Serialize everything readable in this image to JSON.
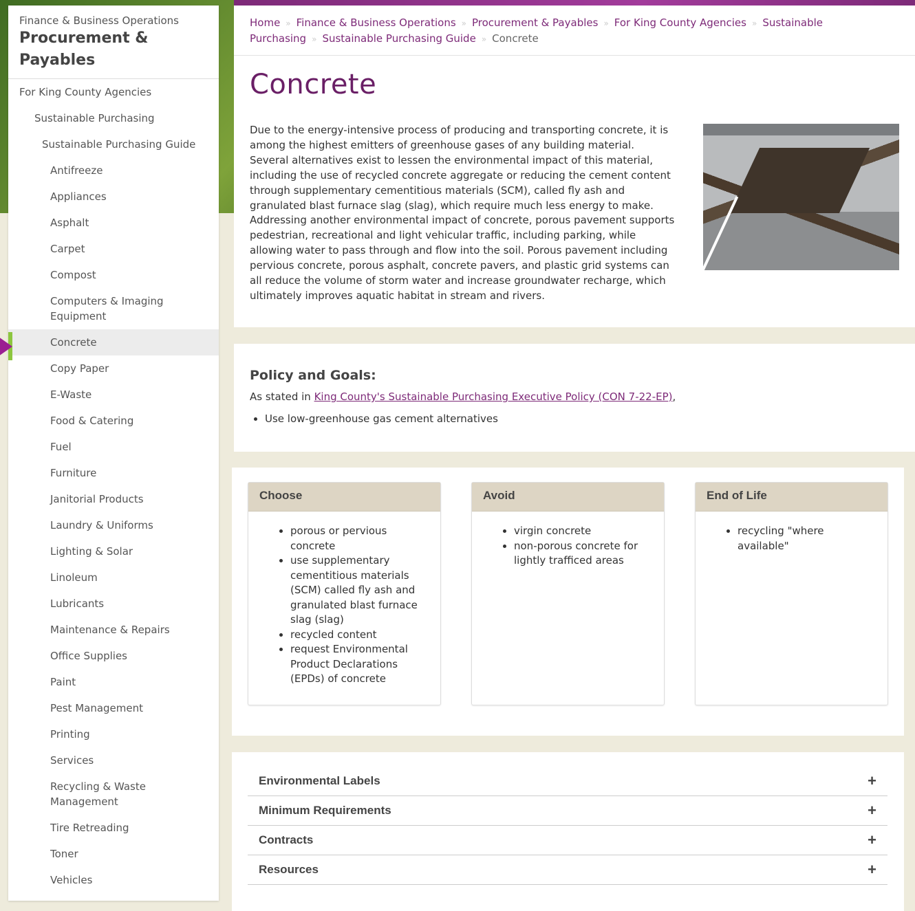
{
  "sidebar": {
    "kicker": "Finance & Business Operations",
    "title": "Procurement & Payables",
    "items": [
      {
        "label": "For King County Agencies",
        "level": 0
      },
      {
        "label": "Sustainable Purchasing",
        "level": 1
      },
      {
        "label": "Sustainable Purchasing Guide",
        "level": 2
      },
      {
        "label": "Antifreeze",
        "level": 3
      },
      {
        "label": "Appliances",
        "level": 3
      },
      {
        "label": "Asphalt",
        "level": 3
      },
      {
        "label": "Carpet",
        "level": 3
      },
      {
        "label": "Compost",
        "level": 3
      },
      {
        "label": "Computers & Imaging Equipment",
        "level": 3
      },
      {
        "label": "Concrete",
        "level": 3,
        "active": true
      },
      {
        "label": "Copy Paper",
        "level": 3
      },
      {
        "label": "E-Waste",
        "level": 3
      },
      {
        "label": "Food & Catering",
        "level": 3
      },
      {
        "label": "Fuel",
        "level": 3
      },
      {
        "label": "Furniture",
        "level": 3
      },
      {
        "label": "Janitorial Products",
        "level": 3
      },
      {
        "label": "Laundry & Uniforms",
        "level": 3
      },
      {
        "label": "Lighting & Solar",
        "level": 3
      },
      {
        "label": "Linoleum",
        "level": 3
      },
      {
        "label": "Lubricants",
        "level": 3
      },
      {
        "label": "Maintenance & Repairs",
        "level": 3
      },
      {
        "label": "Office Supplies",
        "level": 3
      },
      {
        "label": "Paint",
        "level": 3
      },
      {
        "label": "Pest Management",
        "level": 3
      },
      {
        "label": "Printing",
        "level": 3
      },
      {
        "label": "Services",
        "level": 3
      },
      {
        "label": "Recycling & Waste Management",
        "level": 3
      },
      {
        "label": "Tire Retreading",
        "level": 3
      },
      {
        "label": "Toner",
        "level": 3
      },
      {
        "label": "Vehicles",
        "level": 3
      }
    ]
  },
  "breadcrumb": {
    "items": [
      "Home",
      "Finance & Business Operations",
      "Procurement & Payables",
      "For King County Agencies",
      "Sustainable Purchasing",
      "Sustainable Purchasing Guide"
    ],
    "current": "Concrete"
  },
  "page": {
    "title": "Concrete",
    "intro": "Due to the energy-intensive process of producing and transporting concrete, it is among the highest emitters of greenhouse gases of any building material. Several alternatives exist to lessen the environmental impact of this material, including the use of recycled concrete aggregate or reducing the cement content through supplementary cementitious materials (SCM), called fly ash and granulated blast furnace slag (slag), which require much less energy to make. Addressing another environmental impact of concrete, porous pavement supports pedestrian, recreational and light vehicular traffic, including parking, while allowing water to pass through and flow into the soil. Porous pavement including pervious concrete, porous asphalt, concrete pavers, and plastic grid systems can all reduce the volume of storm water and increase groundwater recharge, which ultimately improves aquatic habitat in stream and rivers."
  },
  "policy": {
    "heading": "Policy and Goals:",
    "stated_prefix": "As stated in ",
    "link": "King County's Sustainable Purchasing Executive Policy (CON 7-22-EP)",
    "stated_suffix": ",",
    "goals": [
      "Use low-greenhouse gas cement alternatives"
    ]
  },
  "cards": [
    {
      "title": "Choose",
      "items": [
        "porous or pervious concrete",
        "use supplementary cementitious materials (SCM) called fly ash and granulated blast furnace slag (slag)",
        "recycled content",
        "request Environmental Product Declarations (EPDs) of concrete"
      ]
    },
    {
      "title": "Avoid",
      "items": [
        "virgin concrete",
        "non-porous concrete for lightly trafficed areas"
      ]
    },
    {
      "title": "End of Life",
      "items": [
        "recycling \"where available\""
      ]
    }
  ],
  "accordion": [
    {
      "label": "Environmental Labels",
      "icon": "plus-icon",
      "glyph": "+"
    },
    {
      "label": "Minimum Requirements",
      "icon": "plus-icon",
      "glyph": "+"
    },
    {
      "label": "Contracts",
      "icon": "plus-icon",
      "glyph": "+"
    },
    {
      "label": "Resources",
      "icon": "plus-icon",
      "glyph": "+"
    }
  ],
  "colors": {
    "accent": "#7d2a78",
    "title": "#6a1f66",
    "active_marker": "#9b1f92",
    "active_bar": "#8dc63f",
    "card_head": "#ddd5c4",
    "page_bg": "#eeebdc"
  }
}
